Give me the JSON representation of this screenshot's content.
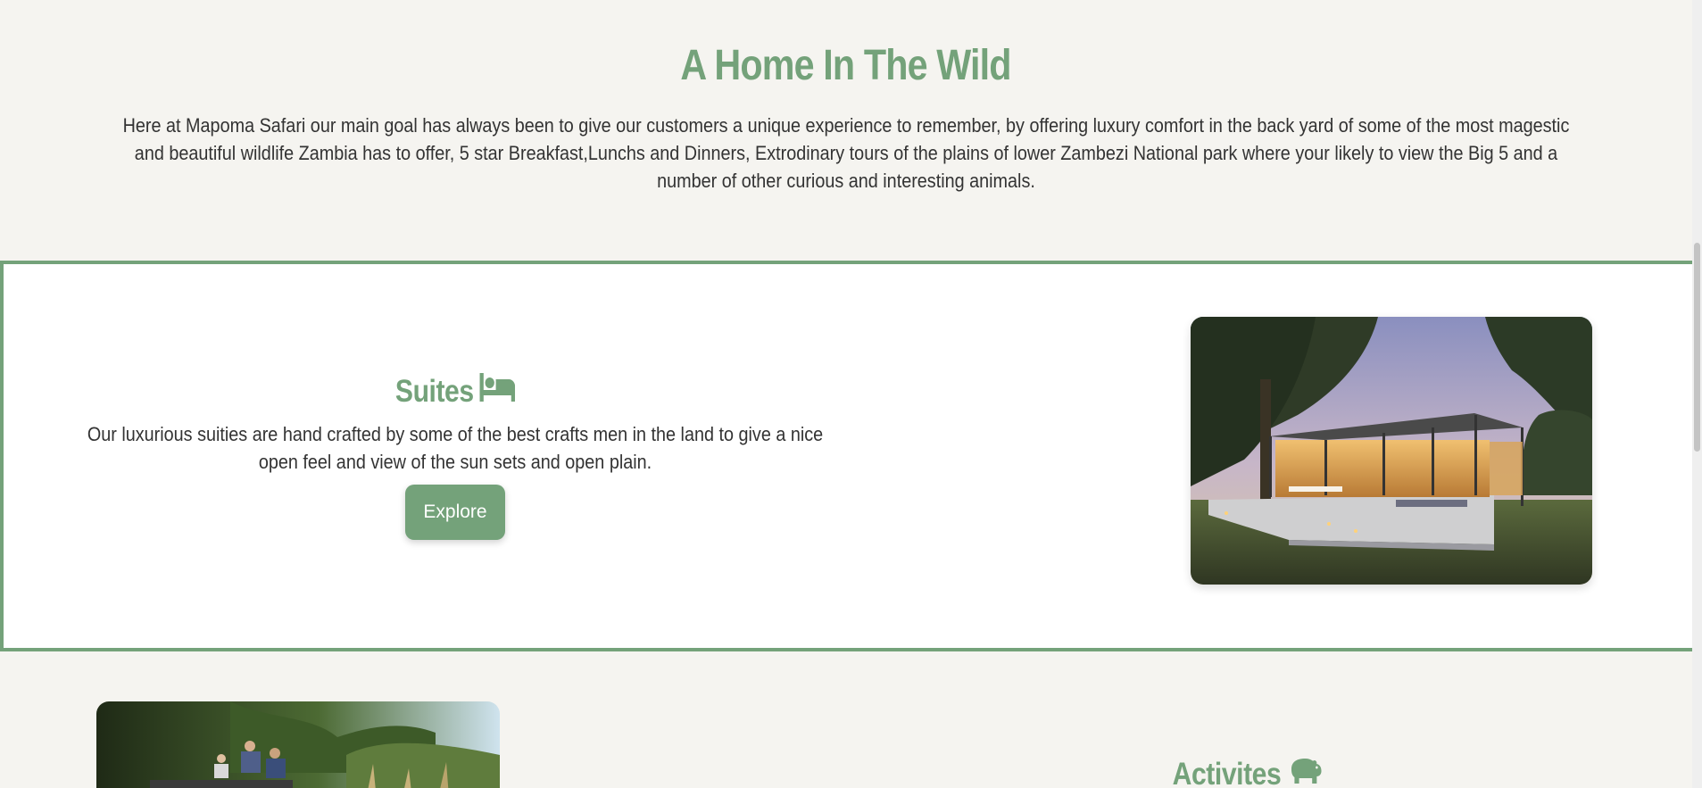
{
  "intro": {
    "title": "A Home In The Wild",
    "text": "Here at Mapoma Safari our main goal has always been to give our customers a unique experience to remember, by offering luxury comfort in the back yard of some of the most magestic and beautiful wildlife Zambia has to offer, 5 star Breakfast,Lunchs and Dinners, Extrodinary tours of the plains of lower Zambezi National park where your likely to view the Big 5 and a number of other curious and interesting animals."
  },
  "suites": {
    "heading": "Suites",
    "icon": "bed-icon",
    "text": "Our luxurious suities are hand crafted by some of the best crafts men in the land to give a nice open feel and view of the sun sets and open plain.",
    "button_label": "Explore"
  },
  "activities": {
    "heading": "Activites",
    "icon": "hippo-icon"
  },
  "colors": {
    "accent": "#74a27a",
    "background": "#f5f4f0",
    "card": "#ffffff",
    "text": "#333333"
  }
}
